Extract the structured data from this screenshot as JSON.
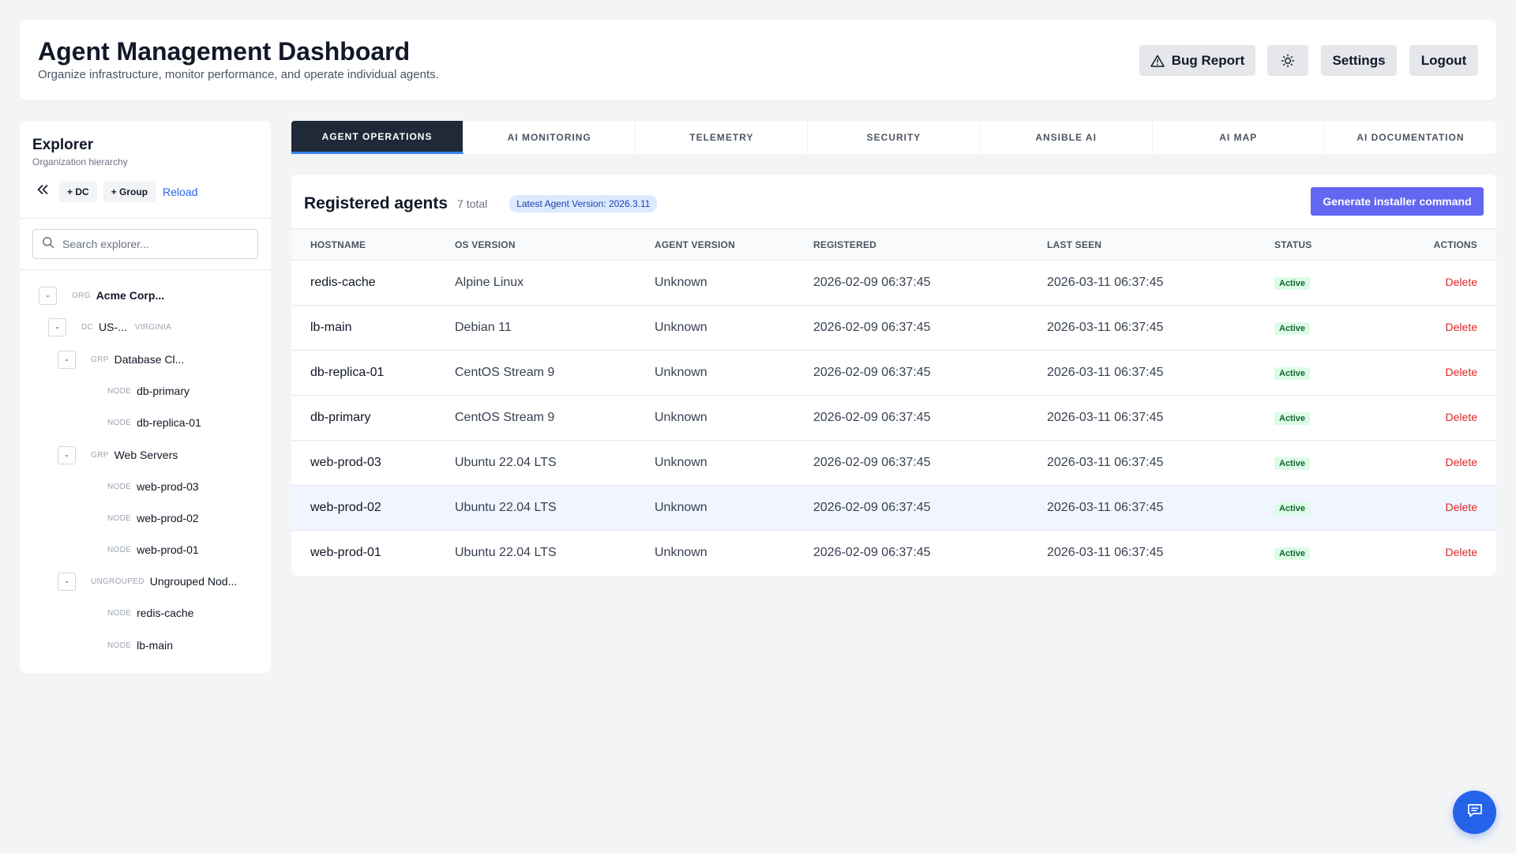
{
  "header": {
    "title": "Agent Management Dashboard",
    "subtitle": "Organize infrastructure, monitor performance, and operate individual agents.",
    "bug_report_label": "Bug Report",
    "settings_label": "Settings",
    "logout_label": "Logout"
  },
  "explorer": {
    "title": "Explorer",
    "subtitle": "Organization hierarchy",
    "add_dc_label": "+ DC",
    "add_group_label": "+ Group",
    "reload_label": "Reload",
    "search_placeholder": "Search explorer...",
    "toggle_symbol": "-",
    "tree": [
      {
        "kind": "ORG",
        "name": "Acme Corp..."
      },
      {
        "kind": "DC",
        "name": "US-...",
        "region": "VIRGINIA"
      },
      {
        "kind": "GRP",
        "name": "Database Cl..."
      },
      {
        "kind": "NODE",
        "name": "db-primary"
      },
      {
        "kind": "NODE",
        "name": "db-replica-01"
      },
      {
        "kind": "GRP",
        "name": "Web Servers"
      },
      {
        "kind": "NODE",
        "name": "web-prod-03"
      },
      {
        "kind": "NODE",
        "name": "web-prod-02"
      },
      {
        "kind": "NODE",
        "name": "web-prod-01"
      },
      {
        "kind": "UNGROUPED",
        "name": "Ungrouped Nod..."
      },
      {
        "kind": "NODE",
        "name": "redis-cache"
      },
      {
        "kind": "NODE",
        "name": "lb-main"
      }
    ]
  },
  "tabs": [
    {
      "label": "AGENT OPERATIONS",
      "active": true
    },
    {
      "label": "AI MONITORING"
    },
    {
      "label": "TELEMETRY"
    },
    {
      "label": "SECURITY"
    },
    {
      "label": "ANSIBLE AI"
    },
    {
      "label": "AI MAP"
    },
    {
      "label": "AI DOCUMENTATION"
    }
  ],
  "agents_panel": {
    "title": "Registered agents",
    "count": "7 total",
    "version_badge": "Latest Agent Version: 2026.3.11",
    "generate_button": "Generate installer command",
    "columns": [
      "HOSTNAME",
      "OS VERSION",
      "AGENT VERSION",
      "REGISTERED",
      "LAST SEEN",
      "STATUS",
      "ACTIONS"
    ],
    "rows": [
      {
        "hostname": "redis-cache",
        "os": "Alpine Linux",
        "agent_version": "Unknown",
        "registered": "2026-02-09 06:37:45",
        "last_seen": "2026-03-11 06:37:45",
        "status": "Active",
        "action": "Delete"
      },
      {
        "hostname": "lb-main",
        "os": "Debian 11",
        "agent_version": "Unknown",
        "registered": "2026-02-09 06:37:45",
        "last_seen": "2026-03-11 06:37:45",
        "status": "Active",
        "action": "Delete"
      },
      {
        "hostname": "db-replica-01",
        "os": "CentOS Stream 9",
        "agent_version": "Unknown",
        "registered": "2026-02-09 06:37:45",
        "last_seen": "2026-03-11 06:37:45",
        "status": "Active",
        "action": "Delete"
      },
      {
        "hostname": "db-primary",
        "os": "CentOS Stream 9",
        "agent_version": "Unknown",
        "registered": "2026-02-09 06:37:45",
        "last_seen": "2026-03-11 06:37:45",
        "status": "Active",
        "action": "Delete"
      },
      {
        "hostname": "web-prod-03",
        "os": "Ubuntu 22.04 LTS",
        "agent_version": "Unknown",
        "registered": "2026-02-09 06:37:45",
        "last_seen": "2026-03-11 06:37:45",
        "status": "Active",
        "action": "Delete"
      },
      {
        "hostname": "web-prod-02",
        "os": "Ubuntu 22.04 LTS",
        "agent_version": "Unknown",
        "registered": "2026-02-09 06:37:45",
        "last_seen": "2026-03-11 06:37:45",
        "status": "Active",
        "action": "Delete"
      },
      {
        "hostname": "web-prod-01",
        "os": "Ubuntu 22.04 LTS",
        "agent_version": "Unknown",
        "registered": "2026-02-09 06:37:45",
        "last_seen": "2026-03-11 06:37:45",
        "status": "Active",
        "action": "Delete"
      }
    ]
  },
  "colors": {
    "accent": "#6366f1",
    "active_tab": "#1f2937",
    "danger": "#dc2626",
    "success_bg": "#dcfce7",
    "success_text": "#166534",
    "chat_button": "#2563eb"
  },
  "icons": {
    "bug_report": "warning-triangle-icon",
    "theme": "sun-icon",
    "collapse": "double-chevron-left-icon",
    "search": "search-icon",
    "chat": "chat-bubble-icon"
  }
}
